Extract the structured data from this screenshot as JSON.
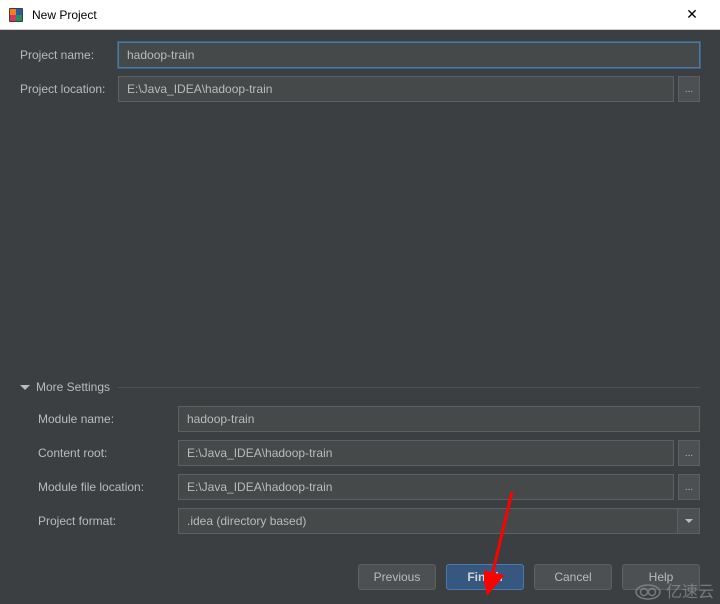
{
  "titlebar": {
    "title": "New Project",
    "close": "✕"
  },
  "top_form": {
    "project_name_label": "Project name:",
    "project_name_value": "hadoop-train",
    "project_location_label": "Project location:",
    "project_location_value": "E:\\Java_IDEA\\hadoop-train",
    "browse": "..."
  },
  "expander": {
    "label": "More Settings"
  },
  "more": {
    "module_name_label": "Module name:",
    "module_name_value": "hadoop-train",
    "content_root_label": "Content root:",
    "content_root_value": "E:\\Java_IDEA\\hadoop-train",
    "module_file_label": "Module file location:",
    "module_file_value": "E:\\Java_IDEA\\hadoop-train",
    "project_format_label": "Project format:",
    "project_format_value": ".idea (directory based)",
    "browse": "..."
  },
  "buttons": {
    "previous": "Previous",
    "finish": "Finish",
    "cancel": "Cancel",
    "help": "Help"
  },
  "watermark": {
    "text": "亿速云"
  }
}
